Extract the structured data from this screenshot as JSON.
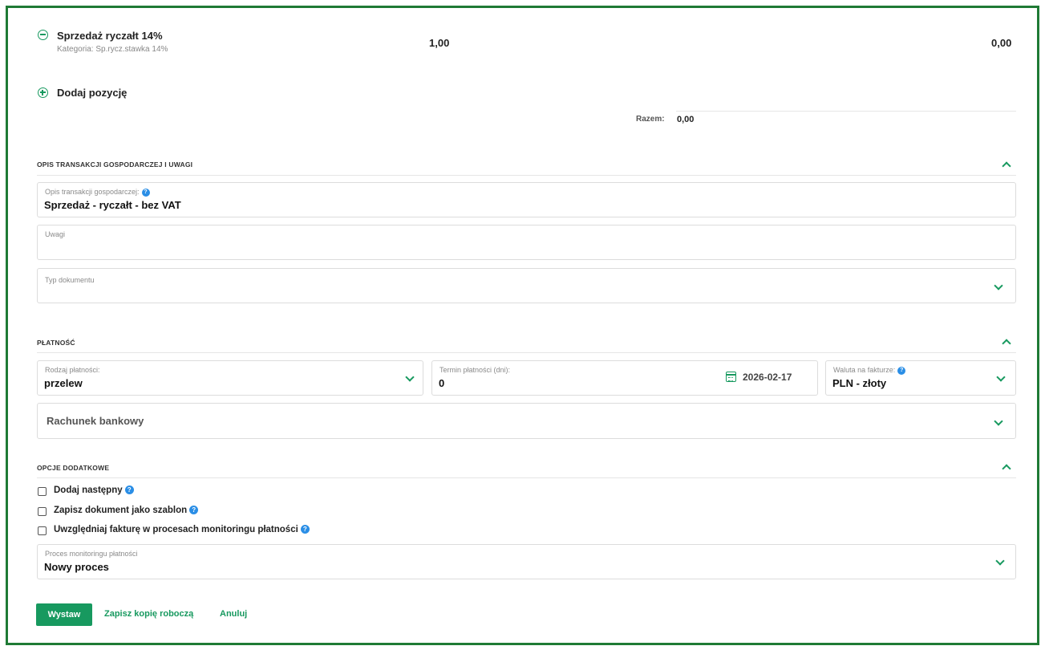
{
  "items": [
    {
      "name": "Sprzedaż ryczałt 14%",
      "category": "Kategoria: Sp.rycz.stawka 14%",
      "quantity": "1,00",
      "amount": "0,00"
    }
  ],
  "add_item": {
    "label": "Dodaj pozycję"
  },
  "total": {
    "label": "Razem:",
    "value": "0,00"
  },
  "section_description": {
    "title": "OPIS TRANSAKCJI GOSPODARCZEJ I UWAGI",
    "transaction_label": "Opis transakcji gospodarczej:",
    "transaction_value": "Sprzedaż - ryczałt - bez VAT",
    "notes_label": "Uwagi",
    "notes_value": "",
    "doc_type_label": "Typ dokumentu",
    "doc_type_value": ""
  },
  "section_payment": {
    "title": "PŁATNOŚĆ",
    "payment_type_label": "Rodzaj płatności:",
    "payment_type_value": "przelew",
    "term_label": "Termin płatności (dni):",
    "term_value": "0",
    "term_date": "2026-02-17",
    "currency_label": "Waluta na fakturze:",
    "currency_value": "PLN - złoty",
    "bank_account_label": "Rachunek bankowy"
  },
  "section_options": {
    "title": "OPCJE DODATKOWE",
    "checkboxes": [
      {
        "label": "Dodaj następny",
        "checked": false
      },
      {
        "label": "Zapisz dokument jako szablon",
        "checked": false
      },
      {
        "label": "Uwzględniaj fakturę w procesach monitoringu płatności",
        "checked": false
      }
    ],
    "monitoring_label": "Proces monitoringu płatności",
    "monitoring_value": "Nowy proces"
  },
  "actions": {
    "issue": "Wystaw",
    "save_draft": "Zapisz kopię roboczą",
    "cancel": "Anuluj"
  },
  "colors": {
    "accent": "#17995f",
    "frame": "#1f7a35",
    "help": "#2a8ee6"
  }
}
